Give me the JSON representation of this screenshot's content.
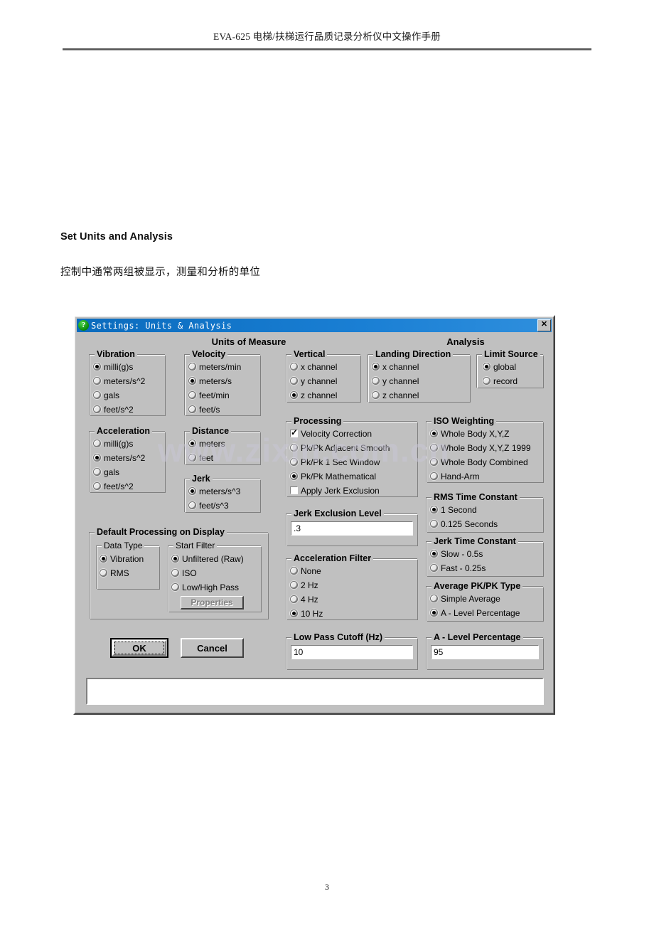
{
  "document": {
    "header": "EVA-625 电梯/扶梯运行品质记录分析仪中文操作手册",
    "heading": "Set Units and Analysis",
    "paragraph": "控制中通常两组被显示，测量和分析的单位",
    "page_number": "3",
    "watermark": "www.zixin.com.cn"
  },
  "dialog": {
    "title": "Settings: Units & Analysis",
    "title_icon": "?",
    "close_label": "✕",
    "section_units": "Units of Measure",
    "section_analysis": "Analysis",
    "groups": {
      "vibration": {
        "label": "Vibration",
        "options": [
          "milli(g)s",
          "meters/s^2",
          "gals",
          "feet/s^2"
        ],
        "selected": 0
      },
      "velocity": {
        "label": "Velocity",
        "options": [
          "meters/min",
          "meters/s",
          "feet/min",
          "feet/s"
        ],
        "selected": 1
      },
      "acceleration": {
        "label": "Acceleration",
        "options": [
          "milli(g)s",
          "meters/s^2",
          "gals",
          "feet/s^2"
        ],
        "selected": 1
      },
      "distance": {
        "label": "Distance",
        "options": [
          "meters",
          "feet"
        ],
        "selected": 0
      },
      "jerk": {
        "label": "Jerk",
        "options": [
          "meters/s^3",
          "feet/s^3"
        ],
        "selected": 0
      },
      "default_processing": {
        "label": "Default Processing on Display",
        "data_type": {
          "label": "Data Type",
          "options": [
            "Vibration",
            "RMS"
          ],
          "selected": 0
        },
        "start_filter": {
          "label": "Start Filter",
          "options": [
            "Unfiltered (Raw)",
            "ISO",
            "Low/High Pass"
          ],
          "selected": 0,
          "properties_button": "Properties"
        }
      },
      "vertical": {
        "label": "Vertical",
        "options": [
          "x channel",
          "y channel",
          "z channel"
        ],
        "selected": 2
      },
      "landing_direction": {
        "label": "Landing Direction",
        "options": [
          "x channel",
          "y channel",
          "z channel"
        ],
        "selected": 0
      },
      "limit_source": {
        "label": "Limit Source",
        "options": [
          "global",
          "record"
        ],
        "selected": 0
      },
      "processing": {
        "label": "Processing",
        "checkbox_velocity_correction": {
          "label": "Velocity Correction",
          "checked": true
        },
        "radios": [
          "Pk/Pk Adjacent Smooth",
          "Pk/Pk 1 Sec Window",
          "Pk/Pk Mathematical"
        ],
        "radio_selected": 2,
        "checkbox_apply_jerk_exclusion": {
          "label": "Apply Jerk Exclusion",
          "checked": false
        }
      },
      "jerk_exclusion_level": {
        "label": "Jerk Exclusion Level",
        "value": ".3"
      },
      "acceleration_filter": {
        "label": "Acceleration Filter",
        "options": [
          "None",
          "2 Hz",
          "4 Hz",
          "10 Hz"
        ],
        "selected": 3
      },
      "low_pass_cutoff": {
        "label": "Low Pass Cutoff (Hz)",
        "value": "10"
      },
      "iso_weighting": {
        "label": "ISO Weighting",
        "options": [
          "Whole Body X,Y,Z",
          "Whole Body X,Y,Z 1999",
          "Whole Body Combined",
          "Hand-Arm"
        ],
        "selected": 0
      },
      "rms_time_constant": {
        "label": "RMS Time Constant",
        "options": [
          "1 Second",
          "0.125 Seconds"
        ],
        "selected": 0
      },
      "jerk_time_constant": {
        "label": "Jerk Time Constant",
        "options": [
          "Slow - 0.5s",
          "Fast - 0.25s"
        ],
        "selected": 0
      },
      "average_pkpk_type": {
        "label": "Average PK/PK Type",
        "options": [
          "Simple Average",
          "A - Level Percentage"
        ],
        "selected": 1
      },
      "a_level_percentage": {
        "label": "A - Level Percentage",
        "value": "95"
      }
    },
    "buttons": {
      "ok": "OK",
      "cancel": "Cancel"
    },
    "status_text": ""
  }
}
